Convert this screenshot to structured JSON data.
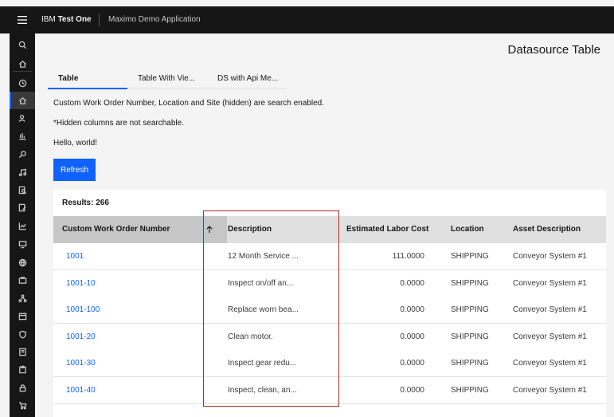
{
  "header": {
    "brand_prefix": "IBM",
    "brand_name": "Test One",
    "app_name": "Maximo Demo Application"
  },
  "sidenav": {
    "icons": [
      "search-icon",
      "home-icon",
      "recent-icon",
      "home-icon",
      "user-icon",
      "chart-icon",
      "tools-icon",
      "music-icon",
      "search-doc-icon",
      "doc-edit-icon",
      "line-chart-icon",
      "screen-icon",
      "globe-icon",
      "briefcase-icon",
      "network-icon",
      "calendar-icon",
      "shield-icon",
      "notebook-icon",
      "clipboard-icon",
      "lock-icon",
      "cart-icon"
    ]
  },
  "page": {
    "title": "Datasource Table",
    "tabs": [
      {
        "label": "Table"
      },
      {
        "label": "Table With Vie..."
      },
      {
        "label": "DS with Api Me..."
      }
    ],
    "info_lines": [
      "Custom Work Order Number, Location and Site (hidden) are search enabled.",
      "*Hidden columns are not searchable.",
      "Hello, world!"
    ],
    "refresh_label": "Refresh"
  },
  "table": {
    "results_label": "Results: 266",
    "columns": [
      "Custom Work Order Number",
      "Description",
      "Estimated Labor Cost",
      "Location",
      "Asset Description"
    ],
    "rows": [
      {
        "wonum": "1001",
        "description": "12 Month Service ...",
        "cost": "111.0000",
        "location": "SHIPPING",
        "asset": "Conveyor System #1"
      },
      {
        "wonum": "1001-10",
        "description": "Inspect on/off an...",
        "cost": "0.0000",
        "location": "SHIPPING",
        "asset": "Conveyor System #1"
      },
      {
        "wonum": "1001-100",
        "description": "Replace worn bea...",
        "cost": "0.0000",
        "location": "SHIPPING",
        "asset": "Conveyor System #1"
      },
      {
        "wonum": "1001-20",
        "description": "Clean motor.",
        "cost": "0.0000",
        "location": "SHIPPING",
        "asset": "Conveyor System #1"
      },
      {
        "wonum": "1001-30",
        "description": "Inspect gear redu...",
        "cost": "0.0000",
        "location": "SHIPPING",
        "asset": "Conveyor System #1"
      },
      {
        "wonum": "1001-40",
        "description": "Inspect, clean, an...",
        "cost": "0.0000",
        "location": "SHIPPING",
        "asset": "Conveyor System #1"
      }
    ]
  },
  "colors": {
    "accent": "#0f62fe",
    "header_bg": "#161616",
    "annotation": "#b3261e"
  }
}
